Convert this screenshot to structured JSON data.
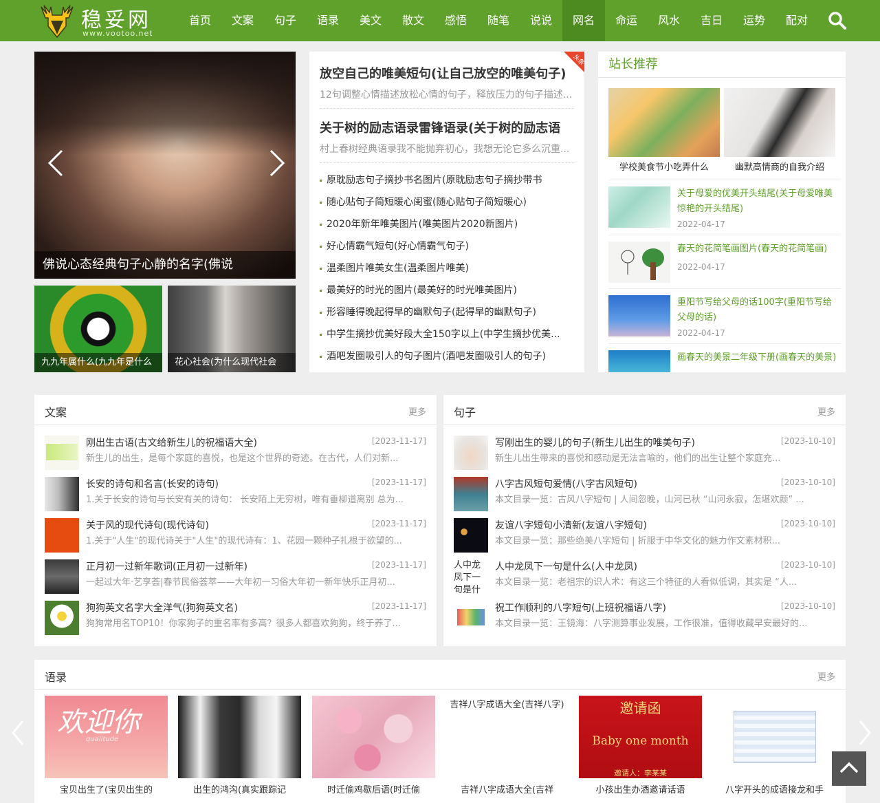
{
  "site": {
    "logo_text": "稳妥网",
    "logo_url": "www.vootoo.net"
  },
  "nav": {
    "items": [
      {
        "label": "首页"
      },
      {
        "label": "文案"
      },
      {
        "label": "句子"
      },
      {
        "label": "语录"
      },
      {
        "label": "美文"
      },
      {
        "label": "散文"
      },
      {
        "label": "感悟"
      },
      {
        "label": "随笔"
      },
      {
        "label": "说说"
      },
      {
        "label": "网名",
        "active": true
      },
      {
        "label": "命运"
      },
      {
        "label": "风水"
      },
      {
        "label": "吉日"
      },
      {
        "label": "运势"
      },
      {
        "label": "配对"
      }
    ],
    "search_icon": "search-icon"
  },
  "slider": {
    "caption": "佛说心态经典句子心静的名字(佛说",
    "thumbs": [
      {
        "caption": "九九年属什么(九九年是什么"
      },
      {
        "caption": "花心社会(为什么现代社会"
      }
    ]
  },
  "headlines": {
    "badge": "头条",
    "top": [
      {
        "title": "放空自己的唯美短句(让自己放空的唯美句子)",
        "desc": "12句调整心情描述放松心情的句子，释放压力的句子描述..."
      },
      {
        "title": "关于树的励志语录雷锋语录(关于树的励志语",
        "desc": "村上春树经典语录我不能抛弃初心，我想无论它多么沉重..."
      }
    ],
    "list": [
      "原耽励志句子摘抄书名图片(原耽励志句子摘抄带书",
      "随心贴句子简短暖心闺蜜(随心贴句子简短暖心)",
      "2020年新年唯美图片(唯美图片2020新图片)",
      "好心情霸气短句(好心情霸气句子)",
      "温柔图片唯美女生(温柔图片唯美)",
      "最美好的时光的图片(最美好的时光唯美图片)",
      "形容睡得晚起得早的幽默句子(起得早的幽默句子)",
      "中学生摘抄优美好段大全150字以上(中学生摘抄优美...",
      "酒吧发圈吸引人的句子图片(酒吧发圈吸引人的句子)"
    ]
  },
  "recommend": {
    "title": "站长推荐",
    "pics": [
      {
        "caption": "学校美食节小吃弄什么"
      },
      {
        "caption": "幽默高情商的自我介绍"
      }
    ],
    "items": [
      {
        "title": "关于母爱的优美开头结尾(关于母爱唯美惊艳的开头结尾)",
        "date": "2022-04-17"
      },
      {
        "title": "春天的花简笔画图片(春天的花简笔画)",
        "date": "2022-04-17"
      },
      {
        "title": "重阳节写给父母的话100字(重阳节写给父母的话)",
        "date": "2022-04-17"
      },
      {
        "title": "画春天的美景二年级下册(画春天的美景)",
        "date": ""
      }
    ]
  },
  "wenan": {
    "title": "文案",
    "more": "更多",
    "rows": [
      {
        "title": "刚出生古语(古文给新生儿的祝福语大全)",
        "date": "[2023-11-17]",
        "desc": "新生儿的出生，是每个家庭的喜悦，也是这个世界的奇迹。在古代，人们对新..."
      },
      {
        "title": "长安的诗句和名言(长安的诗句)",
        "date": "[2023-11-17]",
        "desc": "1.关于长安的诗句与长安有关的诗句：  长安陌上无穷树，唯有垂柳道离别 总为..."
      },
      {
        "title": "关于风的现代诗句(现代诗句)",
        "date": "[2023-11-17]",
        "desc": "1.关于\"人生\"的现代诗关于\"人生\"的现代诗有：1、花园一颗种子扎根于欲望的..."
      },
      {
        "title": "正月初一过新年歌词(正月初一过新年)",
        "date": "[2023-11-17]",
        "desc": "一起过大年·艺享荟|春节民俗荟萃——大年初一习俗大年初一新年快乐正月初..."
      },
      {
        "title": "狗狗英文名字大全洋气(狗狗英文名)",
        "date": "[2023-11-17]",
        "desc": "狗狗常用名TOP10！你家狗子的重名率有多高？很多人都喜欢狗狗，终于养了..."
      }
    ]
  },
  "juzi": {
    "title": "句子",
    "more": "更多",
    "rows": [
      {
        "title": "写刚出生的婴儿的句子(新生儿出生的唯美句子)",
        "date": "[2023-10-10]",
        "desc": "新生儿出生带来的喜悦和感动是无法言喻的，他们的出生让整个家庭充..."
      },
      {
        "title": "八字古风短句爱情(八字古风短句)",
        "date": "[2023-10-10]",
        "desc": "本文目录一览：古风八字短句 | 人间忽晚，山河已秋 “山河永寂，怎堪欢颜” ..."
      },
      {
        "title": "友谊八字短句小清新(友谊八字短句)",
        "date": "[2023-10-10]",
        "desc": "本文目录一览：那些绝美八字短句 | 折服于中华文化的魅力作文素材积..."
      },
      {
        "title": "人中龙凤下一句是什么(人中龙凤)",
        "date": "[2023-10-10]",
        "desc": "本文目录一览：老祖宗的识人术：有这三个特征的人看似低调，其实是 “人...",
        "img_text": "人中龙凤下一句是什"
      },
      {
        "title": "祝工作顺利的八字短句(上班祝福语八字)",
        "date": "[2023-10-10]",
        "desc": "本文目录一览：王镜海：八字测算事业发展，工作很准，值得收藏早安最好的..."
      }
    ]
  },
  "yulu": {
    "title": "语录",
    "more": "更多",
    "items": [
      {
        "caption": "宝贝出生了(宝贝出生的",
        "img_text": "欢迎你",
        "img_sub": "qualitude"
      },
      {
        "caption": "出生的鸿沟(真实跟踪记"
      },
      {
        "caption": "时迁偷鸡歇后语(时迁偷"
      },
      {
        "caption": "吉祥八字成语大全(吉祥",
        "img_text": "吉祥八字成语大全(吉祥八字)"
      },
      {
        "caption": "小孩出生办酒邀请话语",
        "img_text": "邀请函",
        "img_sub": "Baby one month",
        "img_sub2": "邀请人：李某某"
      },
      {
        "caption": "八字开头的成语接龙和手"
      }
    ]
  },
  "colors": {
    "brand": "#5fa12a",
    "nav_active": "#4d8a1f",
    "link_green": "#5fa12a",
    "badge_red": "#e8452c"
  }
}
